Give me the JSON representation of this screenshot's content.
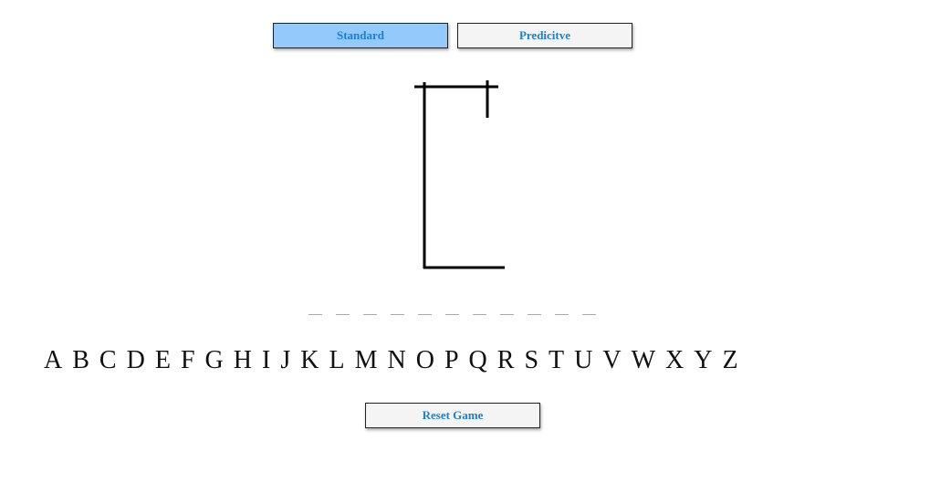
{
  "mode_buttons": {
    "standard_label": "Standard",
    "predictive_label": "Predicitve",
    "active": "standard"
  },
  "word": {
    "length": 11,
    "revealed": [
      "",
      "",
      "",
      "",
      "",
      "",
      "",
      "",
      "",
      "",
      ""
    ]
  },
  "alphabet": [
    "A",
    "B",
    "C",
    "D",
    "E",
    "F",
    "G",
    "H",
    "I",
    "J",
    "K",
    "L",
    "M",
    "N",
    "O",
    "P",
    "Q",
    "R",
    "S",
    "T",
    "U",
    "V",
    "W",
    "X",
    "Y",
    "Z"
  ],
  "reset_label": "Reset Game",
  "colors": {
    "active_button_bg": "#93c9fb",
    "inactive_button_bg": "#f4f4f4",
    "button_text": "#1a7fd8"
  }
}
